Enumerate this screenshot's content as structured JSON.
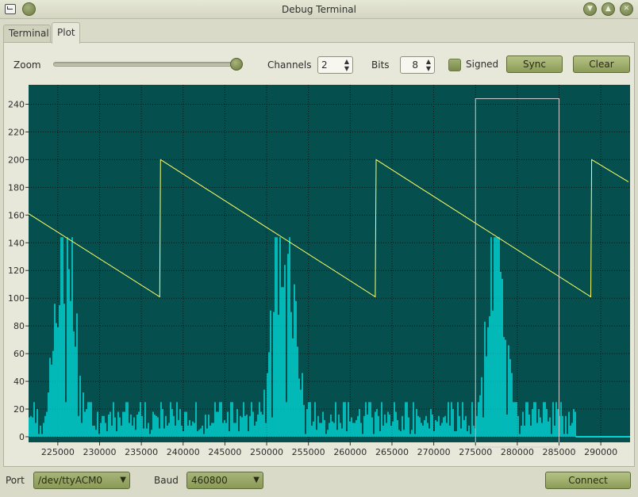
{
  "window": {
    "title": "Debug Terminal"
  },
  "tabs": [
    {
      "label": "Terminal",
      "active": false
    },
    {
      "label": "Plot",
      "active": true
    }
  ],
  "toolbar": {
    "zoom_label": "Zoom",
    "zoom_value": 0.97,
    "channels_label": "Channels",
    "channels_value": "2",
    "bits_label": "Bits",
    "bits_value": "8",
    "signed_label": "Signed",
    "signed_checked": false,
    "sync_label": "Sync",
    "clear_label": "Clear"
  },
  "chart_data": {
    "type": "line",
    "x_ticks": [
      225000,
      230000,
      235000,
      240000,
      245000,
      250000,
      255000,
      260000,
      265000,
      270000,
      275000,
      280000,
      285000,
      290000
    ],
    "x_tick_labels": [
      "225000",
      "230000",
      "235000",
      "240000",
      "245000",
      "250000",
      "255000",
      "260000",
      "265000",
      "270000",
      "275000",
      "280000",
      "285000",
      "290000"
    ],
    "y_ticks": [
      0,
      20,
      40,
      60,
      80,
      100,
      120,
      140,
      160,
      180,
      200,
      220,
      240
    ],
    "y_tick_labels": [
      "0",
      "20",
      "40",
      "60",
      "80",
      "100",
      "120",
      "140",
      "160",
      "180",
      "200",
      "220",
      "240"
    ],
    "xlim": [
      221500,
      293500
    ],
    "ylim": [
      -4,
      254
    ],
    "grid": true,
    "colors": {
      "background": "#05504e",
      "grid": "#101010",
      "series_1": "#ffff66",
      "series_2": "#00ffff",
      "selection": "#d0d0d0"
    },
    "series": [
      {
        "type": "line",
        "points": [
          [
            221500,
            161
          ],
          [
            237200,
            101
          ],
          [
            237300,
            200
          ],
          [
            263000,
            101
          ],
          [
            263100,
            200
          ],
          [
            288800,
            101
          ],
          [
            288900,
            200
          ],
          [
            293300,
            184
          ]
        ]
      },
      {
        "type": "impulse",
        "bursts": [
          {
            "start": 223500,
            "end": 228500,
            "peak": 144,
            "peak_x": 226000
          },
          {
            "start": 249000,
            "end": 254500,
            "peak": 144,
            "peak_x": 252000
          },
          {
            "start": 275000,
            "end": 279500,
            "peak": 144,
            "peak_x": 277500
          }
        ],
        "baseline_max": 25,
        "active_range": [
          221500,
          287000
        ]
      }
    ],
    "selection": {
      "x_range": [
        275000,
        285000
      ],
      "y_range": [
        -4,
        244
      ]
    }
  },
  "footer": {
    "port_label": "Port",
    "port_value": "/dev/ttyACM0",
    "baud_label": "Baud",
    "baud_value": "460800",
    "connect_label": "Connect"
  }
}
